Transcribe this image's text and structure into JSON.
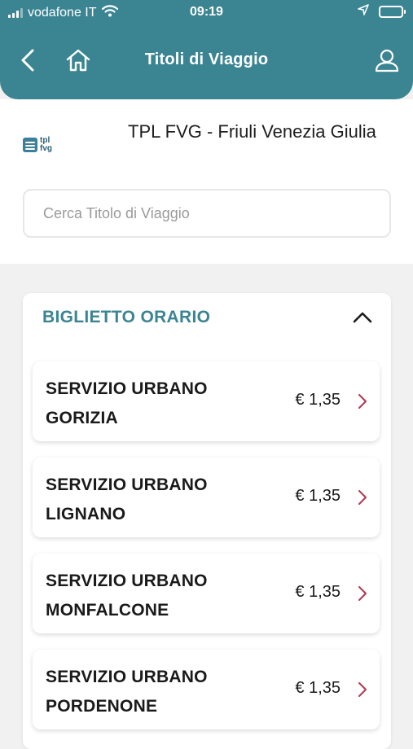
{
  "status_bar": {
    "carrier": "vodafone IT",
    "time": "09:19"
  },
  "header": {
    "title": "Titoli di Viaggio"
  },
  "operator": {
    "logo_text_line1": "tpl",
    "logo_text_line2": "fvg",
    "name": "TPL FVG - Friuli Venezia Giulia"
  },
  "search": {
    "placeholder": "Cerca Titolo di Viaggio"
  },
  "section": {
    "title": "BIGLIETTO ORARIO",
    "items": [
      {
        "line1": "SERVIZIO URBANO",
        "line2": "GORIZIA",
        "price": "€ 1,35"
      },
      {
        "line1": "SERVIZIO URBANO",
        "line2": "LIGNANO",
        "price": "€ 1,35"
      },
      {
        "line1": "SERVIZIO URBANO",
        "line2": "MONFALCONE",
        "price": "€ 1,35"
      },
      {
        "line1": "SERVIZIO URBANO",
        "line2": "PORDENONE",
        "price": "€ 1,35"
      }
    ]
  },
  "colors": {
    "header_bg": "#3b8593",
    "section_title": "#3b8593",
    "arrow": "#b0405e"
  }
}
